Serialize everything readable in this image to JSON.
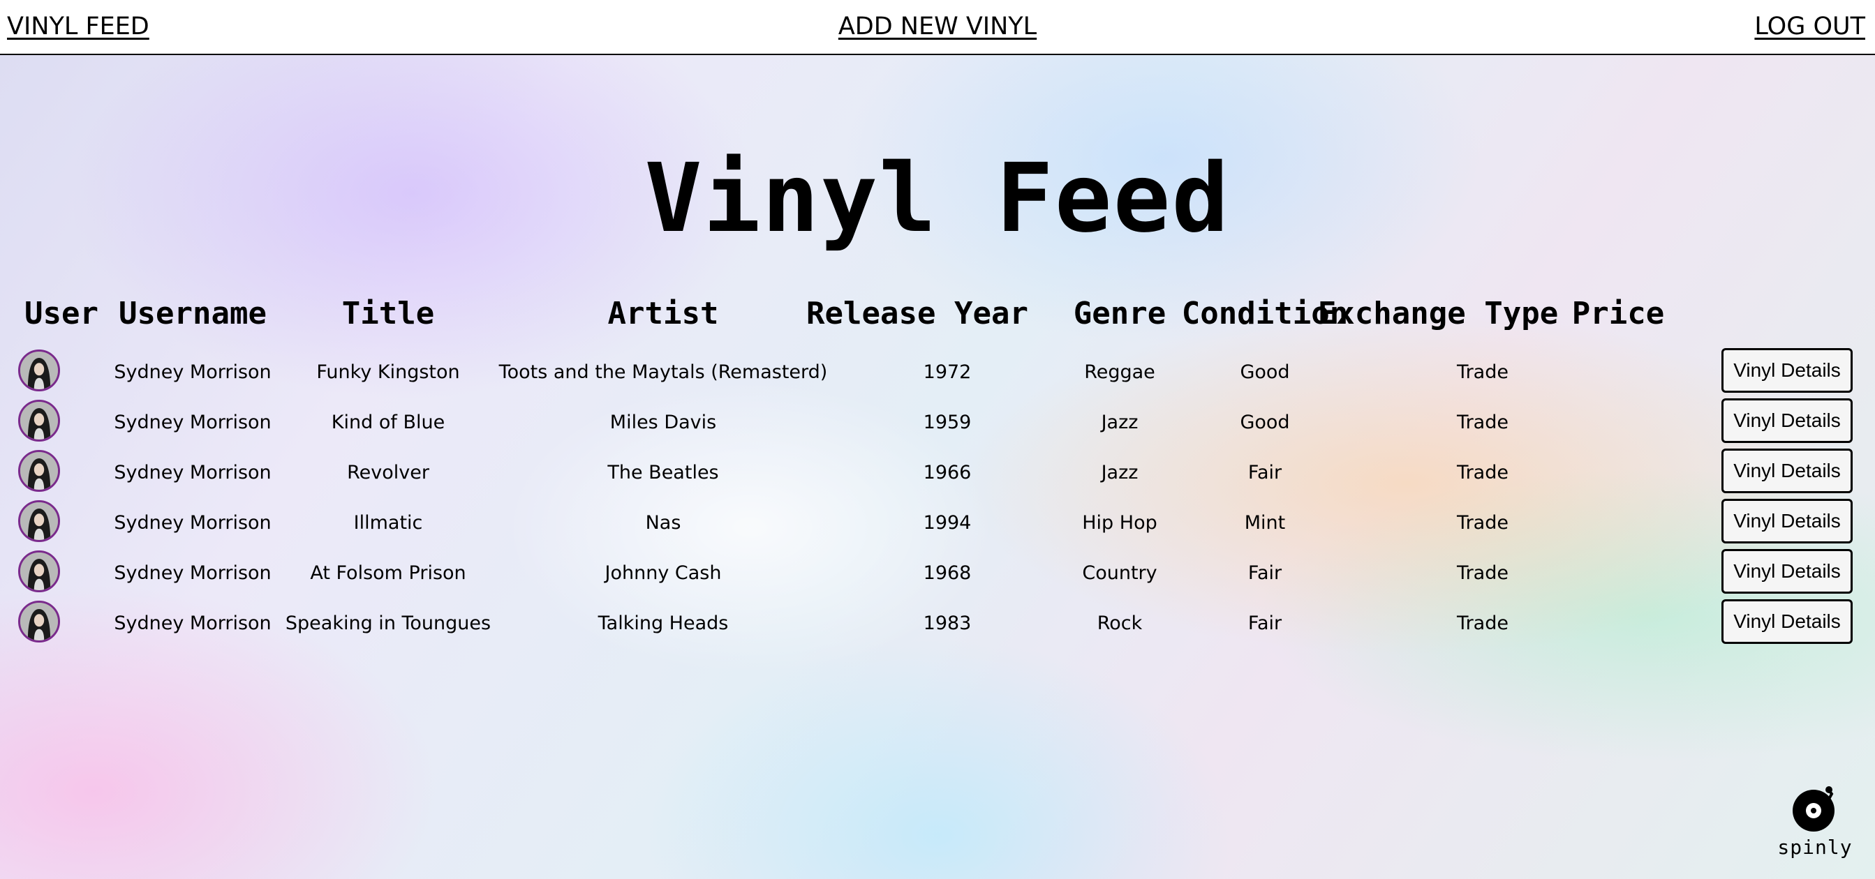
{
  "nav": {
    "feed_label": "VINYL FEED",
    "add_label": "ADD NEW VINYL",
    "logout_label": "LOG OUT"
  },
  "page": {
    "title": "Vinyl Feed"
  },
  "table": {
    "headers": [
      "User",
      "Username",
      "Title",
      "Artist",
      "Release Year",
      "Genre",
      "Condition",
      "Exchange Type",
      "Price"
    ],
    "rows": [
      {
        "avatar": "user-avatar",
        "username": "Sydney Morrison",
        "title": "Funky Kingston",
        "artist": "Toots and the Maytals (Remasterd)",
        "year": "1972",
        "genre": "Reggae",
        "condition": "Good",
        "exchange": "Trade",
        "price": "",
        "button": "Vinyl Details"
      },
      {
        "avatar": "user-avatar",
        "username": "Sydney Morrison",
        "title": "Kind of Blue",
        "artist": "Miles Davis",
        "year": "1959",
        "genre": "Jazz",
        "condition": "Good",
        "exchange": "Trade",
        "price": "",
        "button": "Vinyl Details"
      },
      {
        "avatar": "user-avatar",
        "username": "Sydney Morrison",
        "title": "Revolver",
        "artist": "The Beatles",
        "year": "1966",
        "genre": "Jazz",
        "condition": "Fair",
        "exchange": "Trade",
        "price": "",
        "button": "Vinyl Details"
      },
      {
        "avatar": "user-avatar",
        "username": "Sydney Morrison",
        "title": "Illmatic",
        "artist": "Nas",
        "year": "1994",
        "genre": "Hip Hop",
        "condition": "Mint",
        "exchange": "Trade",
        "price": "",
        "button": "Vinyl Details"
      },
      {
        "avatar": "user-avatar",
        "username": "Sydney Morrison",
        "title": "At Folsom Prison",
        "artist": "Johnny Cash",
        "year": "1968",
        "genre": "Country",
        "condition": "Fair",
        "exchange": "Trade",
        "price": "",
        "button": "Vinyl Details"
      },
      {
        "avatar": "user-avatar",
        "username": "Sydney Morrison",
        "title": "Speaking in Toungues",
        "artist": "Talking Heads",
        "year": "1983",
        "genre": "Rock",
        "condition": "Fair",
        "exchange": "Trade",
        "price": "",
        "button": "Vinyl Details"
      }
    ]
  },
  "brand": {
    "logo_text": "spinly",
    "logo_icon": "vinyl-record-icon"
  },
  "colors": {
    "avatar_ring": "#7a2a8c",
    "text": "#000000",
    "nav_bg": "#ffffff"
  }
}
